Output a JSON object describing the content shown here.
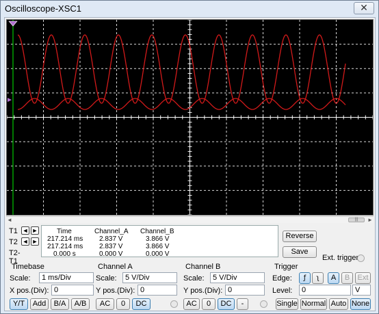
{
  "window": {
    "title": "Oscilloscope-XSC1",
    "close_glyph": "✕"
  },
  "screen": {
    "background": "#000000",
    "grid_color": "#ffffff",
    "trace_color": "#d21a1a",
    "cursor_color": "#00c800",
    "marker_color": "#b070d0"
  },
  "scroll": {
    "left": "◄",
    "right": "►",
    "thumb": "|||"
  },
  "cursors": [
    {
      "label": "T1"
    },
    {
      "label": "T2"
    },
    {
      "label": "T2-T1"
    }
  ],
  "readout": {
    "headers": [
      "Time",
      "Channel_A",
      "Channel_B"
    ],
    "rows": [
      [
        "217.214 ms",
        "2.837 V",
        "3.866 V"
      ],
      [
        "217.214 ms",
        "2.837 V",
        "3.866 V"
      ],
      [
        "0.000 s",
        "0.000 V",
        "0.000 V"
      ]
    ]
  },
  "side_buttons": {
    "reverse": "Reverse",
    "save": "Save"
  },
  "ext_trigger": {
    "label": "Ext. trigger"
  },
  "timebase": {
    "title": "Timebase",
    "scale_label": "Scale:",
    "scale_value": "1 ms/Div",
    "xpos_label": "X pos.(Div):",
    "xpos_value": "0",
    "buttons": [
      "Y/T",
      "Add",
      "B/A",
      "A/B"
    ],
    "active": "Y/T"
  },
  "channel_a": {
    "title": "Channel A",
    "scale_label": "Scale:",
    "scale_value": "5  V/Div",
    "ypos_label": "Y pos.(Div):",
    "ypos_value": "0",
    "buttons": [
      "AC",
      "0",
      "DC"
    ],
    "active": "DC"
  },
  "channel_b": {
    "title": "Channel B",
    "scale_label": "Scale:",
    "scale_value": "5  V/Div",
    "ypos_label": "Y pos.(Div):",
    "ypos_value": "0",
    "buttons": [
      "AC",
      "0",
      "DC",
      "-"
    ],
    "active": "DC"
  },
  "trigger": {
    "title": "Trigger",
    "edge_label": "Edge:",
    "edge_rising": "ƒ",
    "edge_falling": "ʅ",
    "source_buttons": [
      "A",
      "B",
      "Ext"
    ],
    "level_label": "Level:",
    "level_value": "0",
    "level_unit": "V",
    "mode_buttons": [
      "Single",
      "Normal",
      "Auto",
      "None"
    ],
    "active_mode": "None"
  }
}
